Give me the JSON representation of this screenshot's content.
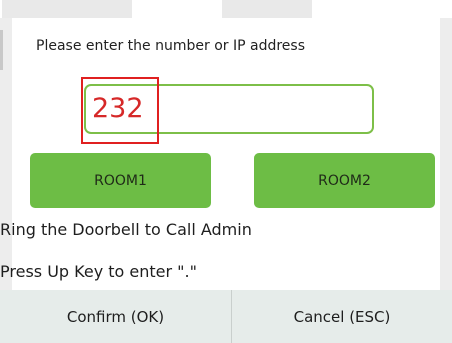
{
  "dialog": {
    "prompt": "Please enter the number or IP address",
    "input_value": "232",
    "room_buttons": [
      "ROOM1",
      "ROOM2"
    ],
    "info_lines": [
      "Ring the Doorbell to Call Admin",
      "Press Up Key to enter \".\""
    ],
    "confirm_label": "Confirm (OK)",
    "cancel_label": "Cancel (ESC)"
  },
  "colors": {
    "accent_green": "#6dbd45",
    "input_border": "#7dbf48",
    "input_text": "#d62828",
    "highlight_box": "#e02020",
    "footer_bg": "#e6ecea"
  }
}
